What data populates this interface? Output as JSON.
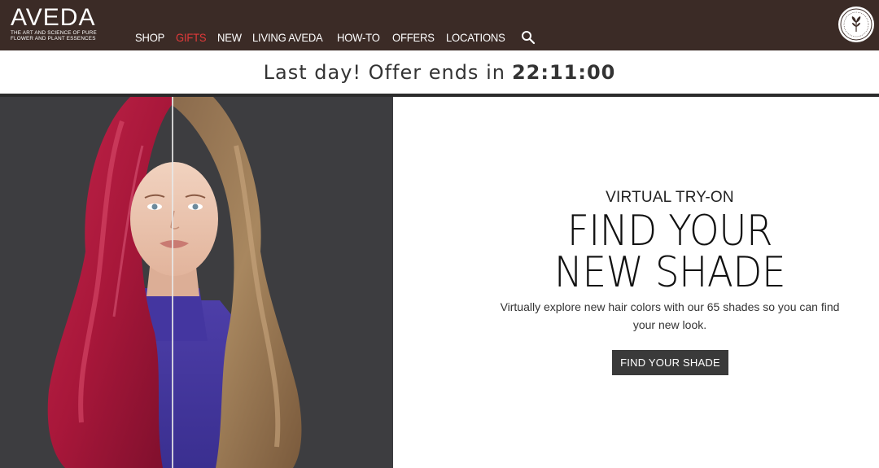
{
  "brand": {
    "name": "AVEDA",
    "tagline_line1": "THE ART AND SCIENCE OF PURE",
    "tagline_line2": "FLOWER AND PLANT ESSENCES"
  },
  "nav": {
    "items": [
      {
        "label": "SHOP"
      },
      {
        "label": "GIFTS"
      },
      {
        "label": "NEW"
      },
      {
        "label": "LIVING AVEDA"
      },
      {
        "label": "HOW-TO"
      },
      {
        "label": "OFFERS"
      },
      {
        "label": "LOCATIONS"
      }
    ],
    "search_icon": "search-icon"
  },
  "offer": {
    "text": "Last day! Offer ends in",
    "countdown": "22:11:00"
  },
  "hero": {
    "kicker": "VIRTUAL TRY-ON",
    "headline_line1": "FIND YOUR",
    "headline_line2": "NEW SHADE",
    "description": "Virtually explore new hair colors with our 65 shades so you can find your new look.",
    "cta_label": "FIND YOUR SHADE"
  },
  "colors": {
    "header_bg": "#3b2b26",
    "gifts_accent": "#e23a3a",
    "cta_bg": "#3a3a3a",
    "image_bg": "#3d3d40"
  }
}
